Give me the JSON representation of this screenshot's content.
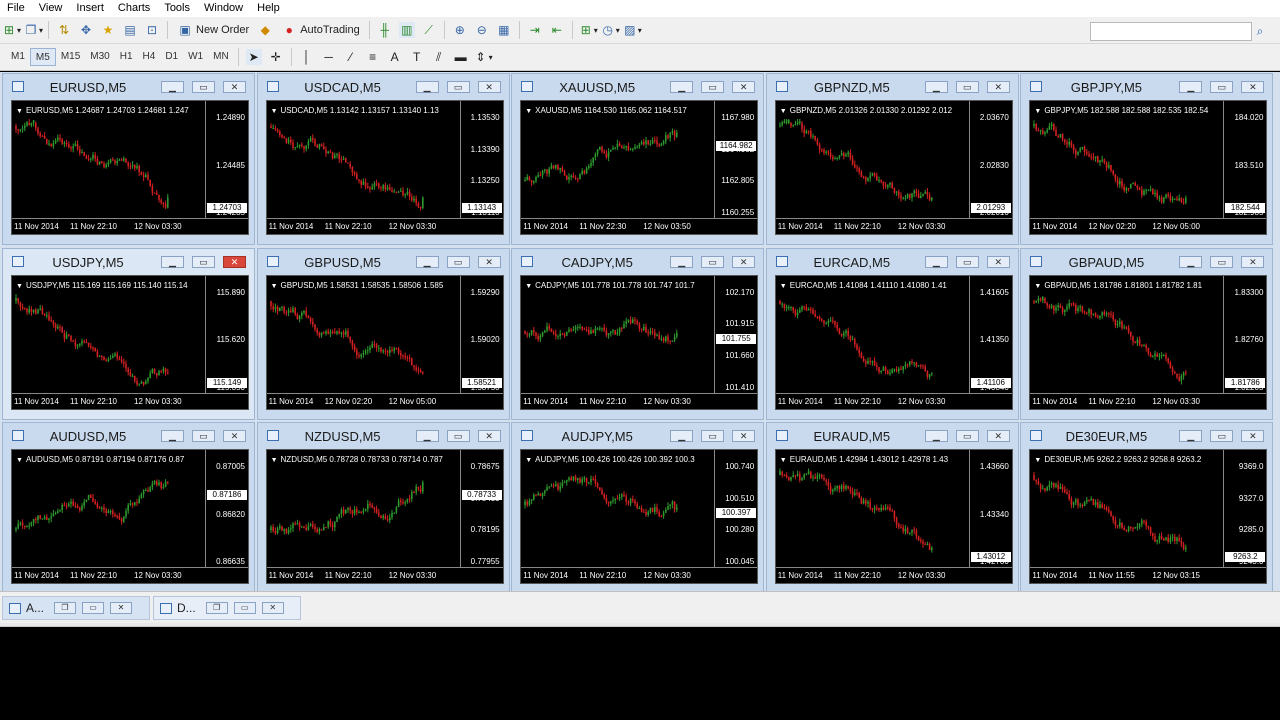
{
  "menu": [
    "File",
    "View",
    "Insert",
    "Charts",
    "Tools",
    "Window",
    "Help"
  ],
  "toolbar": {
    "new_order_label": "New Order",
    "autotrading_label": "AutoTrading",
    "timeframes": [
      "M1",
      "M5",
      "M15",
      "M30",
      "H1",
      "H4",
      "D1",
      "W1",
      "MN"
    ],
    "active_timeframe": "M5"
  },
  "charts": [
    {
      "title": "EURUSD,M5",
      "ohlc": "EURUSD,M5  1.24687 1.24703 1.24681 1.247",
      "prices": [
        "1.24890",
        "1.24485",
        "1.24285"
      ],
      "current": "1.24703",
      "times": [
        "11 Nov 2014",
        "11 Nov 22:10",
        "12 Nov 03:30"
      ],
      "trend": "down",
      "color_bull": "#2e9a2e",
      "color_bear": "#d42020"
    },
    {
      "title": "USDCAD,M5",
      "ohlc": "USDCAD,M5  1.13142 1.13157 1.13140 1.13",
      "prices": [
        "1.13530",
        "1.13390",
        "1.13250",
        "1.13110"
      ],
      "current": "1.13143",
      "times": [
        "11 Nov 2014",
        "11 Nov 22:10",
        "12 Nov 03:30"
      ],
      "trend": "down"
    },
    {
      "title": "XAUUSD,M5",
      "ohlc": "XAUUSD,M5  1164.530 1165.062 1164.517",
      "prices": [
        "1167.980",
        "1164.982",
        "1162.805",
        "1160.255"
      ],
      "current": "1164.982",
      "times": [
        "11 Nov 2014",
        "11 Nov 22:30",
        "12 Nov 03:50"
      ],
      "trend": "up"
    },
    {
      "title": "GBPNZD,M5",
      "ohlc": "GBPNZD,M5  2.01326 2.01330 2.01292 2.012",
      "prices": [
        "2.03670",
        "2.02830",
        "2.02010"
      ],
      "current": "2.01293",
      "times": [
        "11 Nov 2014",
        "11 Nov 22:10",
        "12 Nov 03:30"
      ],
      "trend": "down"
    },
    {
      "title": "GBPJPY,M5",
      "ohlc": "GBPJPY,M5  182.588 182.588 182.535 182.54",
      "prices": [
        "184.020",
        "183.510",
        "182.985"
      ],
      "current": "182.544",
      "times": [
        "11 Nov 2014",
        "12 Nov 02:20",
        "12 Nov 05:00"
      ],
      "trend": "down"
    },
    {
      "title": "USDJPY,M5",
      "ohlc": "USDJPY,M5  115.169 115.169 115.140 115.14",
      "prices": [
        "115.890",
        "115.620",
        "115.350"
      ],
      "current": "115.149",
      "times": [
        "11 Nov 2014",
        "11 Nov 22:10",
        "12 Nov 03:30"
      ],
      "trend": "down",
      "active": true
    },
    {
      "title": "GBPUSD,M5",
      "ohlc": "GBPUSD,M5  1.58531 1.58535 1.58506 1.585",
      "prices": [
        "1.59290",
        "1.59020",
        "1.58750"
      ],
      "current": "1.58521",
      "times": [
        "11 Nov 2014",
        "12 Nov 02:20",
        "12 Nov 05:00"
      ],
      "trend": "down"
    },
    {
      "title": "CADJPY,M5",
      "ohlc": "CADJPY,M5  101.778 101.778 101.747 101.7",
      "prices": [
        "102.170",
        "101.915",
        "101.660",
        "101.410"
      ],
      "current": "101.755",
      "times": [
        "11 Nov 2014",
        "11 Nov 22:10",
        "12 Nov 03:30"
      ],
      "trend": "flat"
    },
    {
      "title": "EURCAD,M5",
      "ohlc": "EURCAD,M5  1.41084 1.41110 1.41080 1.41",
      "prices": [
        "1.41605",
        "1.41350",
        "1.40840"
      ],
      "current": "1.41106",
      "times": [
        "11 Nov 2014",
        "11 Nov 22:10",
        "12 Nov 03:30"
      ],
      "trend": "down"
    },
    {
      "title": "GBPAUD,M5",
      "ohlc": "GBPAUD,M5  1.81786 1.81801 1.81782 1.81",
      "prices": [
        "1.83300",
        "1.82760",
        "1.82205"
      ],
      "current": "1.81786",
      "times": [
        "11 Nov 2014",
        "11 Nov 22:10",
        "12 Nov 03:30"
      ],
      "trend": "down"
    },
    {
      "title": "AUDUSD,M5",
      "ohlc": "AUDUSD,M5  0.87191 0.87194 0.87176 0.87",
      "prices": [
        "0.87005",
        "0.86820",
        "0.86635"
      ],
      "current": "0.87186",
      "times": [
        "11 Nov 2014",
        "11 Nov 22:10",
        "12 Nov 03:30"
      ],
      "trend": "up"
    },
    {
      "title": "NZDUSD,M5",
      "ohlc": "NZDUSD,M5  0.78728 0.78733 0.78714 0.787",
      "prices": [
        "0.78675",
        "0.78435",
        "0.78195",
        "0.77955"
      ],
      "current": "0.78733",
      "times": [
        "11 Nov 2014",
        "11 Nov 22:10",
        "12 Nov 03:30"
      ],
      "trend": "up"
    },
    {
      "title": "AUDJPY,M5",
      "ohlc": "AUDJPY,M5  100.426 100.426 100.392 100.3",
      "prices": [
        "100.740",
        "100.510",
        "100.280",
        "100.045"
      ],
      "current": "100.397",
      "times": [
        "11 Nov 2014",
        "11 Nov 22:10",
        "12 Nov 03:30"
      ],
      "trend": "flat"
    },
    {
      "title": "EURAUD,M5",
      "ohlc": "EURAUD,M5  1.42984 1.43012 1.42978 1.43",
      "prices": [
        "1.43660",
        "1.43340",
        "1.42700"
      ],
      "current": "1.43012",
      "times": [
        "11 Nov 2014",
        "11 Nov 22:10",
        "12 Nov 03:30"
      ],
      "trend": "down"
    },
    {
      "title": "DE30EUR,M5",
      "ohlc": "DE30EUR,M5  9262.2 9263.2 9258.8 9263.2",
      "prices": [
        "9369.0",
        "9327.0",
        "9285.0",
        "9243.0"
      ],
      "current": "9263.2",
      "times": [
        "11 Nov 2014",
        "11 Nov 11:55",
        "12 Nov 03:15"
      ],
      "trend": "down"
    }
  ],
  "tabs": [
    {
      "label": "A..."
    },
    {
      "label": "D..."
    }
  ]
}
